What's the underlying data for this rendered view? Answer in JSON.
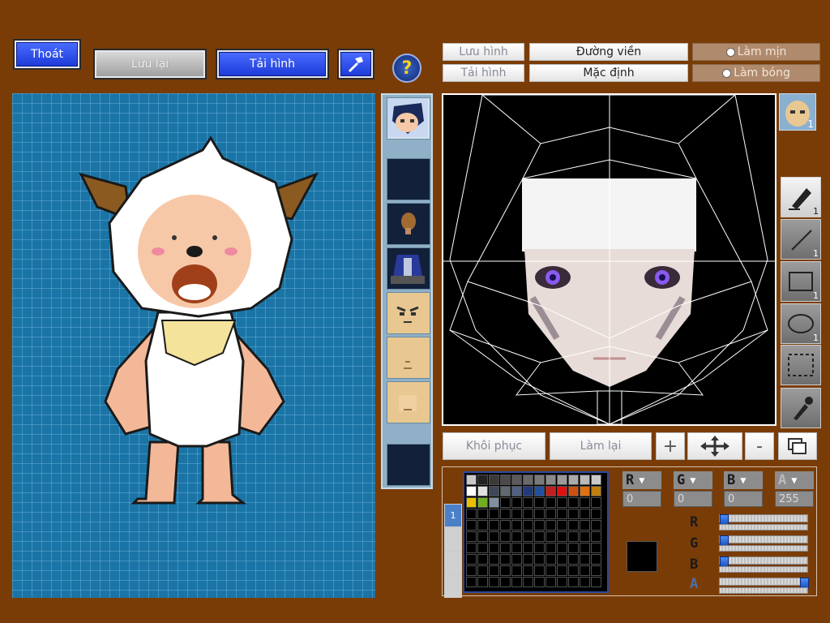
{
  "toolbar": {
    "exit_label": "Thoát",
    "save_label": "Lưu lại",
    "load_label": "Tải hình",
    "help_label": "?"
  },
  "editor": {
    "save_image_label": "Lưu hình",
    "load_image_label": "Tải hình",
    "outline_label": "Đường viền",
    "default_label": "Mặc định",
    "smooth_label": "Làm mịn",
    "shine_label": "Làm bóng",
    "restore_label": "Khôi phục",
    "redo_label": "Làm lại",
    "zoom_in_label": "+",
    "zoom_out_label": "-"
  },
  "tools": [
    {
      "name": "pen-tool",
      "count": "1"
    },
    {
      "name": "line-tool",
      "count": "1"
    },
    {
      "name": "rectangle-tool",
      "count": "1"
    },
    {
      "name": "ellipse-tool",
      "count": "1"
    },
    {
      "name": "select-tool",
      "count": ""
    },
    {
      "name": "eyedropper-tool",
      "count": ""
    }
  ],
  "face_thumb_badge": "1",
  "color": {
    "r_label": "R",
    "g_label": "G",
    "b_label": "B",
    "a_label": "A",
    "r_value": "0",
    "g_value": "0",
    "b_value": "0",
    "a_value": "255",
    "current": "#000000",
    "r_level": 0,
    "g_level": 0,
    "b_level": 0,
    "a_level": 1
  },
  "palette_colors": [
    "#c8c8c8",
    "#222222",
    "#3a3a3a",
    "#4a4a4a",
    "#5a5a5a",
    "#6a6a6a",
    "#7a7a7a",
    "#8a8a8a",
    "#9a9a9a",
    "#aaaaaa",
    "#bababa",
    "#cacaca",
    "#ffffff",
    "#e0e0e0",
    "#404858",
    "#606870",
    "#506080",
    "#203a7a",
    "#2050a0",
    "#c02020",
    "#e01010",
    "#d05010",
    "#e07010",
    "#c08010",
    "#e8c000",
    "#70b020",
    "#8090a0",
    "#000000",
    "#000000",
    "#000000",
    "#000000",
    "#000000",
    "#000000",
    "#000000",
    "#000000",
    "#000000"
  ]
}
